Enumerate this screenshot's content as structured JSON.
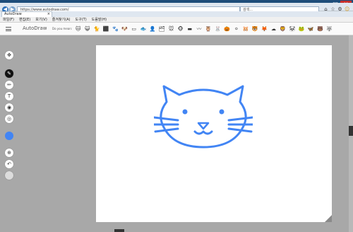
{
  "browser": {
    "url": "https://www.autodraw.com/",
    "search_placeholder": "검색...",
    "tab_title": "AutoDraw",
    "menu": [
      "파일(F)",
      "편집(E)",
      "보기(V)",
      "즐겨찾기(A)",
      "도구(T)",
      "도움말(H)"
    ]
  },
  "app": {
    "title": "AutoDraw",
    "suggest_label": "Do you mean:",
    "suggestions": [
      "🐱",
      "😺",
      "🐈",
      "⬛",
      "🐾",
      "🐶",
      "▭",
      "🐟",
      "👤",
      "🗂",
      "🐭",
      "🐵",
      "▬",
      "〰",
      "🦉",
      "🐰",
      "🎃",
      "⚪",
      "🐹",
      "🐯",
      "🦊",
      "☁",
      "🦁",
      "🐼",
      "🐸",
      "🦋",
      "🐻",
      "🐺"
    ]
  },
  "tools": [
    "select-icon",
    "autodraw-icon",
    "draw-icon",
    "type-icon",
    "fill-icon",
    "shape-icon",
    "color-icon",
    "zoom-icon",
    "undo-icon",
    "delete-icon"
  ],
  "colors": {
    "accent": "#4285f4",
    "chrome": "#1e4d7a"
  }
}
